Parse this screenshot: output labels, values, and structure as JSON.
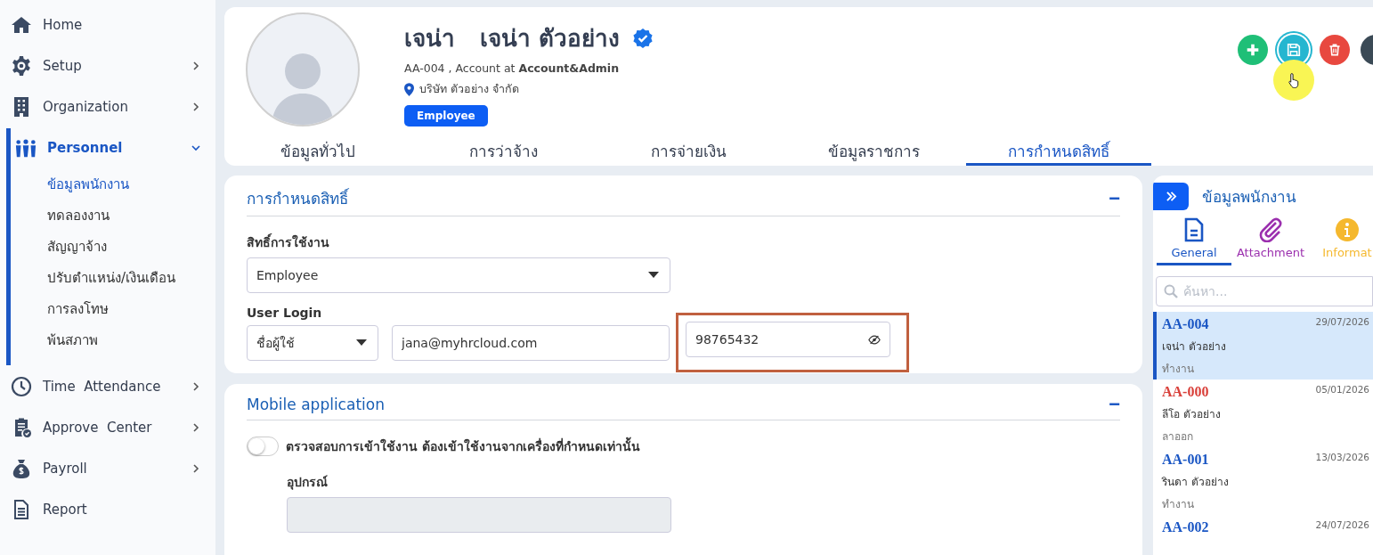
{
  "sidebar": {
    "items": [
      {
        "label": "Home",
        "kind": "link",
        "selected": false
      },
      {
        "label": "Setup",
        "kind": "group",
        "expanded": false,
        "selected": false
      },
      {
        "label": "Organization",
        "kind": "group",
        "expanded": false,
        "selected": false
      },
      {
        "label": "Personnel",
        "kind": "group",
        "expanded": true,
        "selected": true,
        "children": [
          {
            "label": "ข้อมูลพนักงาน",
            "selected": true
          },
          {
            "label": "ทดลองงาน",
            "selected": false
          },
          {
            "label": "สัญญาจ้าง",
            "selected": false
          },
          {
            "label": "ปรับตำแหน่ง/เงินเดือน",
            "selected": false
          },
          {
            "label": "การลงโทษ",
            "selected": false
          },
          {
            "label": "พ้นสภาพ",
            "selected": false
          }
        ]
      },
      {
        "label": "Time  Attendance",
        "kind": "group",
        "expanded": false,
        "selected": false
      },
      {
        "label": "Approve  Center",
        "kind": "group",
        "expanded": false,
        "selected": false
      },
      {
        "label": "Payroll",
        "kind": "group",
        "expanded": false,
        "selected": false
      },
      {
        "label": "Report",
        "kind": "link",
        "selected": false
      }
    ]
  },
  "profile": {
    "nickname": "เจน่า",
    "full_name": "เจน่า ตัวอย่าง",
    "verified": true,
    "subtitle": "AA-004 , Account at **Account&Admin**",
    "company": "บริษัท ตัวอย่าง จำกัด",
    "badge": "Employee"
  },
  "tabs": [
    {
      "label": "ข้อมูลทั่วไป",
      "selected": false
    },
    {
      "label": "การว่าจ้าง",
      "selected": false
    },
    {
      "label": "การจ่ายเงิน",
      "selected": false
    },
    {
      "label": "ข้อมูลราชการ",
      "selected": false
    },
    {
      "label": "การกำหนดสิทธิ์",
      "selected": true
    }
  ],
  "permissions": {
    "title": "การกำหนดสิทธิ์",
    "collapse": "−",
    "role_label": "สิทธิ์การใช้งาน",
    "role_value": "Employee",
    "login_label": "User Login",
    "login_type": "ชื่อผู้ใช้",
    "username": "jana@myhrcloud.com",
    "password": "98765432",
    "password_highlighted": true
  },
  "mobile": {
    "title": "Mobile application",
    "collapse": "−",
    "toggle_on": false,
    "toggle_label": "ตรวจสอบการเข้าใช้งาน ต้องเข้าใช้งานจากเครื่องที่กำหนดเท่านั้น",
    "device_label": "อุปกรณ์",
    "device_disabled": true
  },
  "panel": {
    "title": "ข้อมูลพนักงาน",
    "tabs": [
      {
        "label": "General",
        "color": "#1a56c4",
        "selected": true
      },
      {
        "label": "Attachment",
        "color": "#9b2fae",
        "selected": false
      },
      {
        "label": "Informat",
        "color": "#f5b82e",
        "selected": false
      }
    ],
    "search_placeholder": "ค้นหา...",
    "employees": [
      {
        "code": "AA-004",
        "date": "29/07/2026",
        "name": "เจน่า ตัวอย่าง",
        "status": "ทำงาน",
        "color": "#1a56c4",
        "selected": true
      },
      {
        "code": "AA-000",
        "date": "05/01/2026",
        "name": "ลีโอ ตัวอย่าง",
        "status": "ลาออก",
        "color": "#d9403a",
        "selected": false
      },
      {
        "code": "AA-001",
        "date": "13/03/2026",
        "name": "รินดา ตัวอย่าง",
        "status": "ทำงาน",
        "color": "#1a56c4",
        "selected": false
      },
      {
        "code": "AA-002",
        "date": "24/07/2026",
        "color": "#1a56c4",
        "selected": false
      }
    ]
  }
}
